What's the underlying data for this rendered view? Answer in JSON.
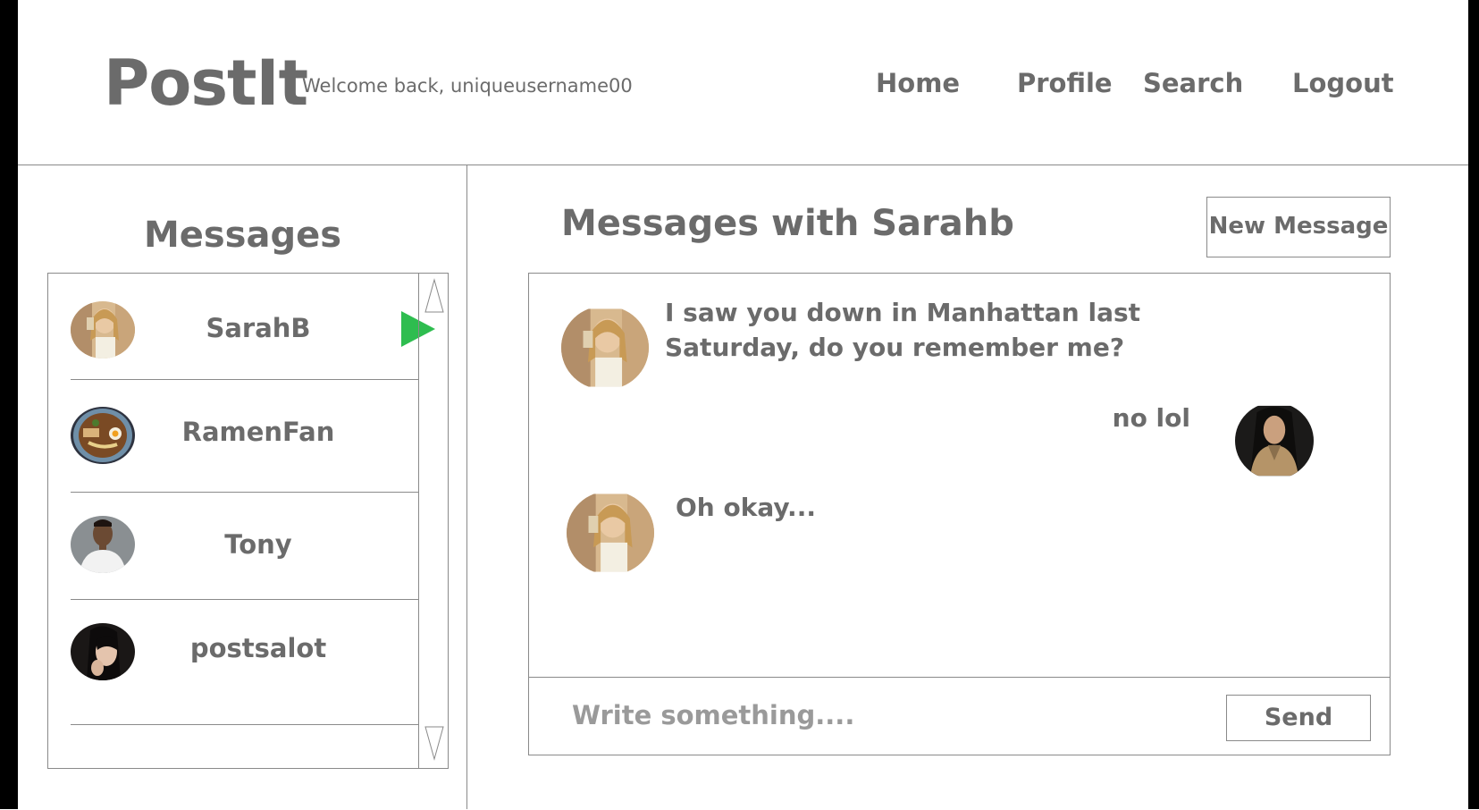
{
  "app": {
    "logo": "PostIt",
    "welcome": "Welcome back, uniqueusername00"
  },
  "nav": {
    "home": "Home",
    "profile": "Profile",
    "search": "Search",
    "logout": "Logout"
  },
  "sidebar": {
    "title": "Messages",
    "conversations": [
      {
        "name": "SarahB",
        "avatar": "sarah-avatar",
        "active": true
      },
      {
        "name": "RamenFan",
        "avatar": "ramen-avatar",
        "active": false
      },
      {
        "name": "Tony",
        "avatar": "tony-avatar",
        "active": false
      },
      {
        "name": "postsalot",
        "avatar": "postsalot-avatar",
        "active": false
      }
    ]
  },
  "main": {
    "title": "Messages with Sarahb",
    "new_message_label": "New Message",
    "messages": [
      {
        "from": "SarahB",
        "side": "left",
        "text": "I saw you down in Manhattan last Saturday, do you remember me?"
      },
      {
        "from": "uniqueusername00",
        "side": "right",
        "text": "no lol"
      },
      {
        "from": "SarahB",
        "side": "left",
        "text": "Oh okay..."
      }
    ],
    "composer": {
      "placeholder": "Write something....",
      "value": "",
      "send_label": "Send"
    }
  },
  "colors": {
    "text": "#6b6b6b",
    "border": "#8a8a8a",
    "active_indicator": "#2ebd4f",
    "frame": "#000000"
  }
}
